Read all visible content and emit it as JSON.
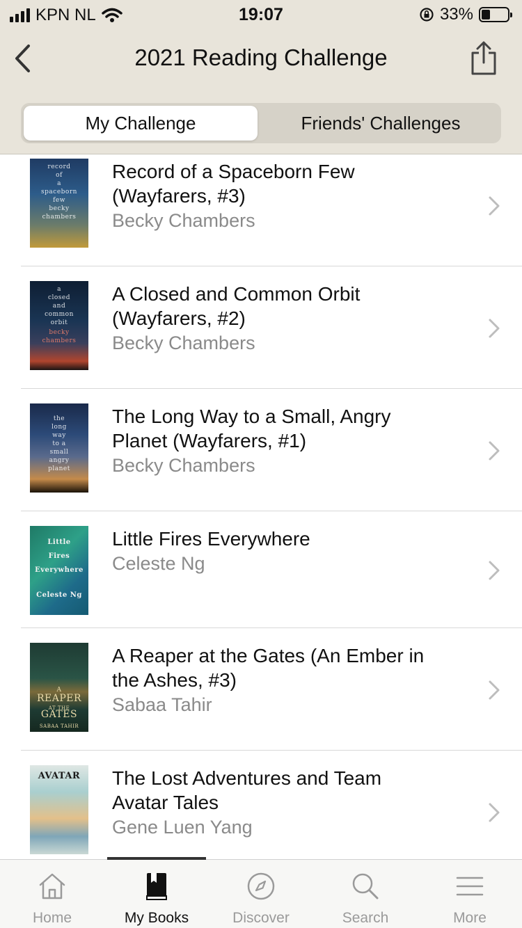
{
  "status": {
    "carrier": "KPN NL",
    "time": "19:07",
    "battery": "33%",
    "battery_level": 0.33
  },
  "nav": {
    "title": "2021 Reading Challenge"
  },
  "segments": {
    "active": "My Challenge",
    "inactive": "Friends' Challenges"
  },
  "books": [
    {
      "title_lines": [
        "Record of a Spaceborn Few",
        "(Wayfarers, #3)"
      ],
      "author": "Becky Chambers",
      "cover_text": [
        "record",
        "of",
        "a",
        "spaceborn",
        "few",
        "becky",
        "chambers"
      ]
    },
    {
      "title_lines": [
        "A Closed and Common Orbit",
        "(Wayfarers, #2)"
      ],
      "author": "Becky Chambers",
      "cover_text": [
        "a",
        "closed",
        "and",
        "common",
        "orbit",
        "becky",
        "chambers"
      ]
    },
    {
      "title_lines": [
        "The Long Way to a Small, Angry",
        "Planet (Wayfarers, #1)"
      ],
      "author": "Becky Chambers",
      "cover_text": [
        "the",
        "long",
        "way",
        "to a",
        "small",
        "angry",
        "planet"
      ]
    },
    {
      "title_lines": [
        "Little Fires Everywhere"
      ],
      "author": "Celeste Ng",
      "cover_text": [
        "Little",
        "Fires",
        "Everywhere",
        "Celeste Ng"
      ]
    },
    {
      "title_lines": [
        "A Reaper at the Gates (An Ember in",
        "the Ashes, #3)"
      ],
      "author": "Sabaa Tahir",
      "cover_text": [
        "A",
        "REAPER",
        "AT THE",
        "GATES",
        "SABAA TAHIR"
      ]
    },
    {
      "title_lines": [
        "The Lost Adventures and Team",
        "Avatar Tales"
      ],
      "author": "Gene Luen Yang",
      "cover_text": [
        "AVATAR"
      ]
    }
  ],
  "tabs": [
    {
      "label": "Home",
      "icon": "home-icon",
      "active": false
    },
    {
      "label": "My Books",
      "icon": "book-icon",
      "active": true
    },
    {
      "label": "Discover",
      "icon": "compass-icon",
      "active": false
    },
    {
      "label": "Search",
      "icon": "search-icon",
      "active": false
    },
    {
      "label": "More",
      "icon": "menu-icon",
      "active": false
    }
  ],
  "colors": {
    "header_bg": "#e8e4da",
    "author_gray": "#8a8a8a"
  }
}
